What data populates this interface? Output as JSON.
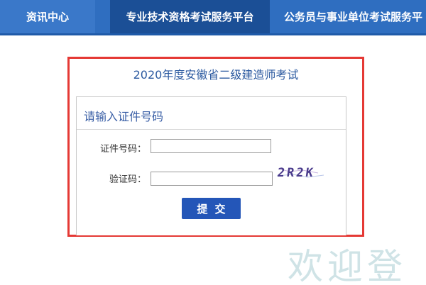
{
  "nav": {
    "items": [
      {
        "label": "资讯中心"
      },
      {
        "label": "专业技术资格考试服务平台"
      },
      {
        "label": "公务员与事业单位考试服务平"
      }
    ]
  },
  "exam": {
    "title": "2020年度安徽省二级建造师考试"
  },
  "form": {
    "heading": "请输入证件号码",
    "id_label": "证件号码：",
    "id_value": "",
    "captcha_label": "验证码：",
    "captcha_value": "",
    "captcha_text": "2R2K",
    "submit_label": "提交"
  },
  "watermark": "欢迎登",
  "colors": {
    "nav_bg": "#2f6ec0",
    "nav_active_bg": "#1b4f96",
    "highlight_frame": "#e53935",
    "button_bg": "#2456b8",
    "title_text": "#2c5aa0"
  }
}
